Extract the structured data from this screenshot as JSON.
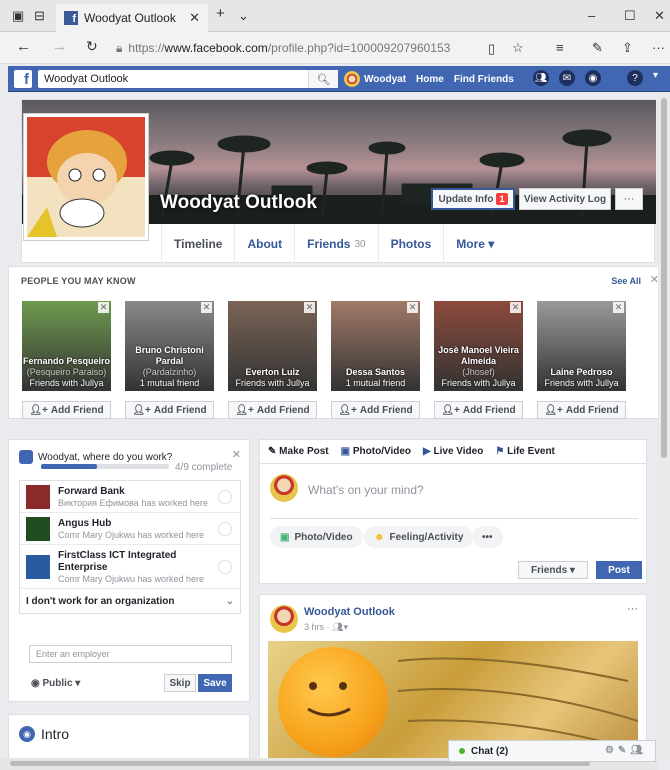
{
  "browser": {
    "tab_title": "Woodyat Outlook",
    "url_prefix": "https://",
    "url_domain": "www.facebook.com",
    "url_path": "/profile.php?id=100009207960153"
  },
  "fbbar": {
    "search_value": "Woodyat Outlook",
    "user_name": "Woodyat",
    "home": "Home",
    "find_friends": "Find Friends"
  },
  "profile": {
    "name": "Woodyat Outlook",
    "update_info": "Update Info",
    "update_badge": "1",
    "view_activity": "View Activity Log",
    "more_dots": "···",
    "tabs": [
      {
        "label": "Timeline"
      },
      {
        "label": "About"
      },
      {
        "label": "Friends",
        "count": "30"
      },
      {
        "label": "Photos"
      },
      {
        "label": "More ▾"
      }
    ]
  },
  "pymk": {
    "title": "PEOPLE YOU MAY KNOW",
    "see_all": "See All",
    "add_label": "Add Friend",
    "people": [
      {
        "name": "Fernando Pesqueiro",
        "alt": "(Pesqueiro Paraiso)",
        "mutual": "Friends with Jullya",
        "color": "#6e9a4f"
      },
      {
        "name": "Bruno Christoni Pardal",
        "alt": "(Pardalzinho)",
        "mutual": "1 mutual friend",
        "color": "#8a8a8a"
      },
      {
        "name": "Everton Luiz",
        "alt": "",
        "mutual": "Friends with Jullya",
        "color": "#7a6456"
      },
      {
        "name": "Dessa Santos",
        "alt": "",
        "mutual": "1 mutual friend",
        "color": "#a07a68"
      },
      {
        "name": "Josè Manoel Vieira Almeida",
        "alt": "(Jhosef)",
        "mutual": "Friends with Jullya",
        "color": "#8c4a3c"
      },
      {
        "name": "Laine Pedroso",
        "alt": "",
        "mutual": "Friends with Jullya",
        "color": "#9a9a9a"
      }
    ]
  },
  "work": {
    "question": "Woodyat, where do you work?",
    "progress_fraction": 0.44,
    "progress_text": "4/9 complete",
    "employers": [
      {
        "name": "Forward Bank",
        "sub": "Виктория Ефимова has worked here",
        "color": "#8b2a2a"
      },
      {
        "name": "Angus Hub",
        "sub": "Comr Mary Ojukwu has worked here",
        "color": "#1f4d1f"
      },
      {
        "name": "FirstClass ICT Integrated Enterprise",
        "sub": "Comr Mary Ojukwu has worked here",
        "color": "#2a5aa0"
      }
    ],
    "no_org": "I don't work for an organization",
    "input_placeholder": "Enter an employer",
    "public": "Public ▾",
    "skip": "Skip",
    "save": "Save"
  },
  "intro": {
    "title": "Intro"
  },
  "composer": {
    "make_post": "Make Post",
    "photo_video_tab": "Photo/Video",
    "live_video": "Live Video",
    "life_event": "Life Event",
    "placeholder": "What's on your mind?",
    "photo_video": "Photo/Video",
    "feeling": "Feeling/Activity",
    "dots": "•••",
    "friends": "Friends ▾",
    "post": "Post"
  },
  "post": {
    "author": "Woodyat Outlook",
    "time": "3 hrs · ",
    "dots": "···"
  },
  "chat": {
    "label": "Chat (2)"
  }
}
